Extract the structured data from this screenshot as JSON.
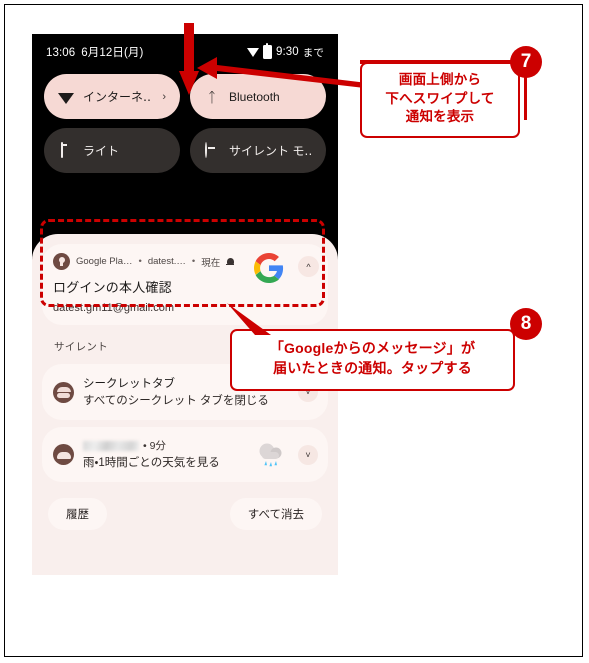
{
  "phone": {
    "status_bar": {
      "time": "13:06",
      "date": "6月12日(月)",
      "wifi_icon": "wifi-icon",
      "battery_icon": "battery-icon",
      "battery_text": "9:30",
      "battery_suffix": "まで"
    },
    "quick_settings": {
      "tiles": [
        {
          "label": "インターネ‥",
          "icon": "wifi-icon",
          "state": "on",
          "chevron": "›"
        },
        {
          "label": "Bluetooth",
          "icon": "bluetooth-icon",
          "state": "on",
          "chevron": ""
        },
        {
          "label": "ライト",
          "icon": "flashlight-icon",
          "state": "off",
          "chevron": ""
        },
        {
          "label": "サイレント モ‥",
          "icon": "do-not-disturb-icon",
          "state": "off",
          "chevron": ""
        }
      ]
    },
    "notification_shade": {
      "google_notification": {
        "app_name": "Google Pla…",
        "account": "datest.…",
        "time": "現在",
        "bell_icon": "bell-icon",
        "app_badge_icon": "key-badge-icon",
        "brand_icon": "google-g-icon",
        "expand_icon": "chevron-up-icon",
        "title": "ログインの本人確認",
        "body": "datest.gm11@gmail.com"
      },
      "silent_section_label": "サイレント",
      "silent_notifications": [
        {
          "icon": "incognito-icon",
          "app_name_blurred": true,
          "time": "",
          "title": "シークレットタブ",
          "body": "すべてのシークレット タブを閉じる",
          "expand_icon": "chevron-down-icon",
          "has_weather_art": false
        },
        {
          "icon": "weather-cloud-icon",
          "app_name_blurred": true,
          "time": "• 9分",
          "title": "",
          "body": "雨・1時間ごとの天気を見る",
          "expand_icon": "chevron-down-icon",
          "has_weather_art": true
        }
      ],
      "actions": {
        "history_label": "履歴",
        "clear_all_label": "すべて消去"
      }
    }
  },
  "annotations": {
    "accent_color": "#cc0000",
    "callouts": [
      {
        "number": "7",
        "text_line1": "画面上側から",
        "text_line2": "下へスワイプして",
        "text_line3": "通知を表示"
      },
      {
        "number": "8",
        "text_line1": "「Googleからのメッセージ」が",
        "text_line2": "届いたときの通知。タップする",
        "text_line3": ""
      }
    ],
    "arrows": [
      {
        "name": "swipe-down-arrow"
      },
      {
        "name": "pointer-arrow-to-statusbar"
      },
      {
        "name": "pointer-arrow-to-notification"
      }
    ],
    "highlight_box": "dashed-highlight-google-notification"
  }
}
